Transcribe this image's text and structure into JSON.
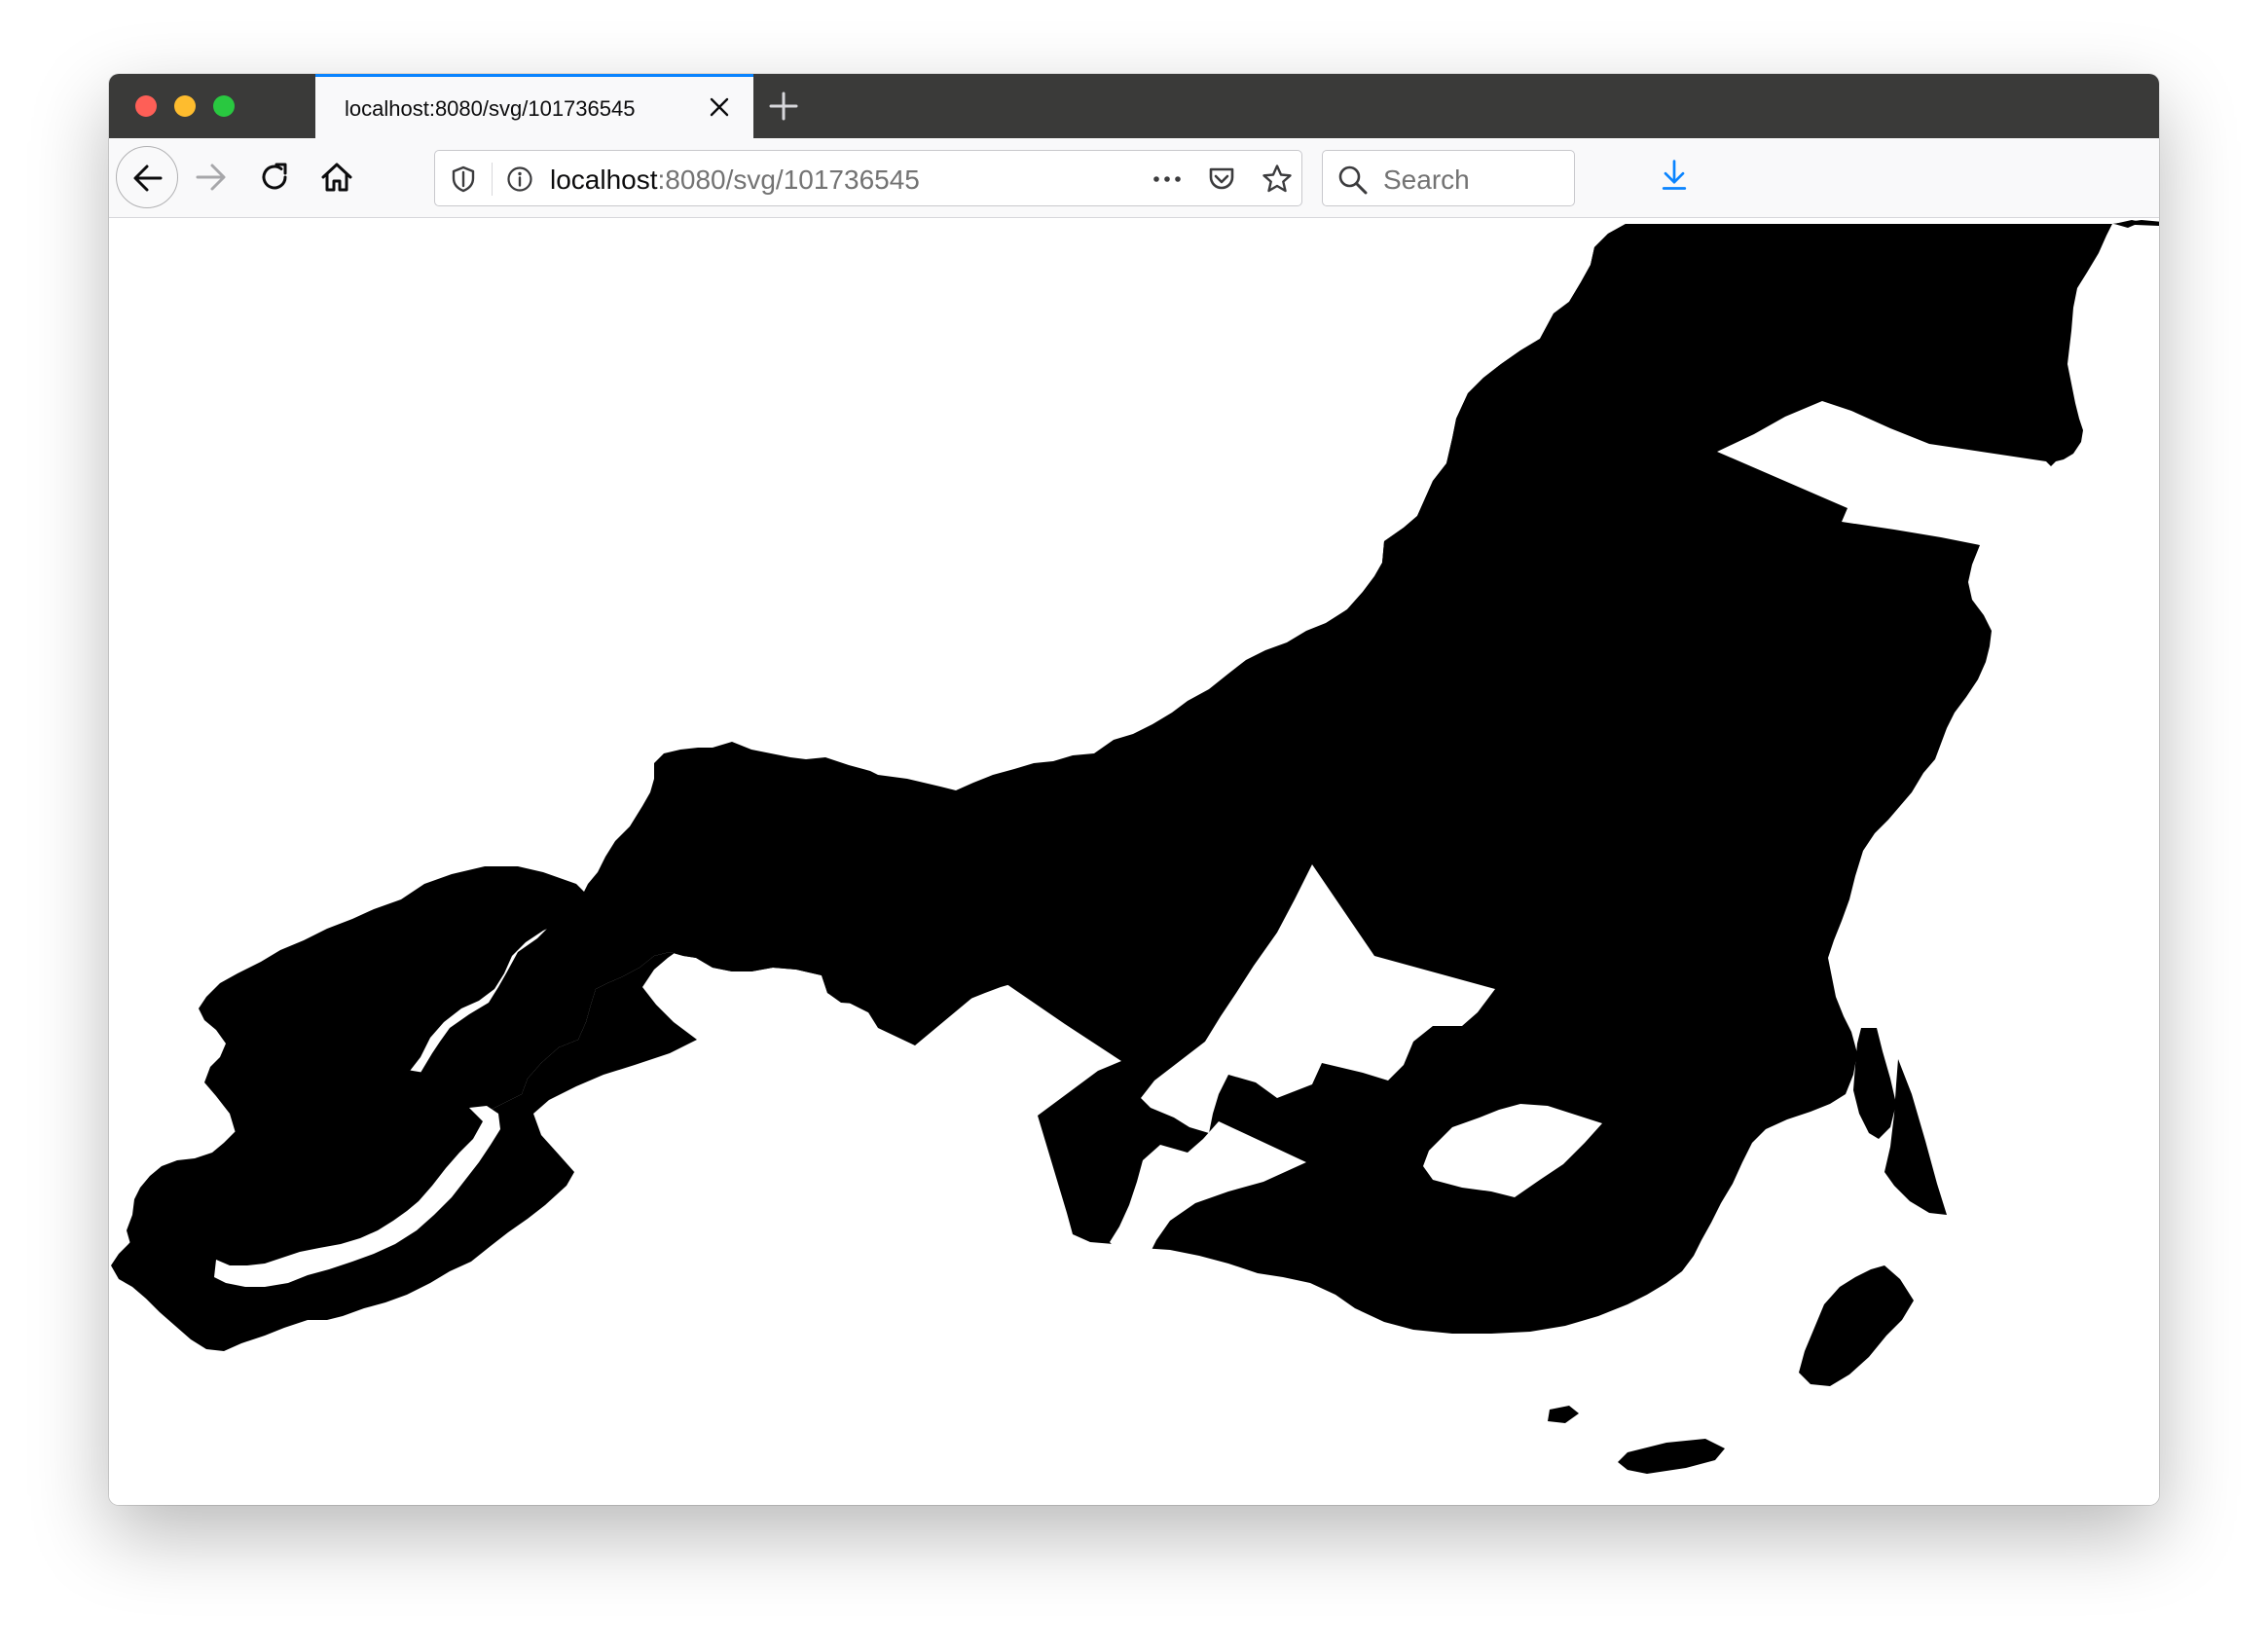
{
  "browser": {
    "tab": {
      "title": "localhost:8080/svg/101736545"
    },
    "url": {
      "host": "localhost",
      "rest": ":8080/svg/101736545"
    },
    "search": {
      "placeholder": "Search"
    },
    "accent_color": "#0a84ff",
    "icons": [
      "close-icon",
      "plus-icon",
      "arrow-left-icon",
      "arrow-right-icon",
      "reload-icon",
      "home-icon",
      "shield-icon",
      "info-icon",
      "more-icon",
      "pocket-icon",
      "star-icon",
      "search-icon",
      "download-icon"
    ]
  },
  "content": {
    "fill_color": "#000000",
    "background_color": "#ffffff"
  }
}
